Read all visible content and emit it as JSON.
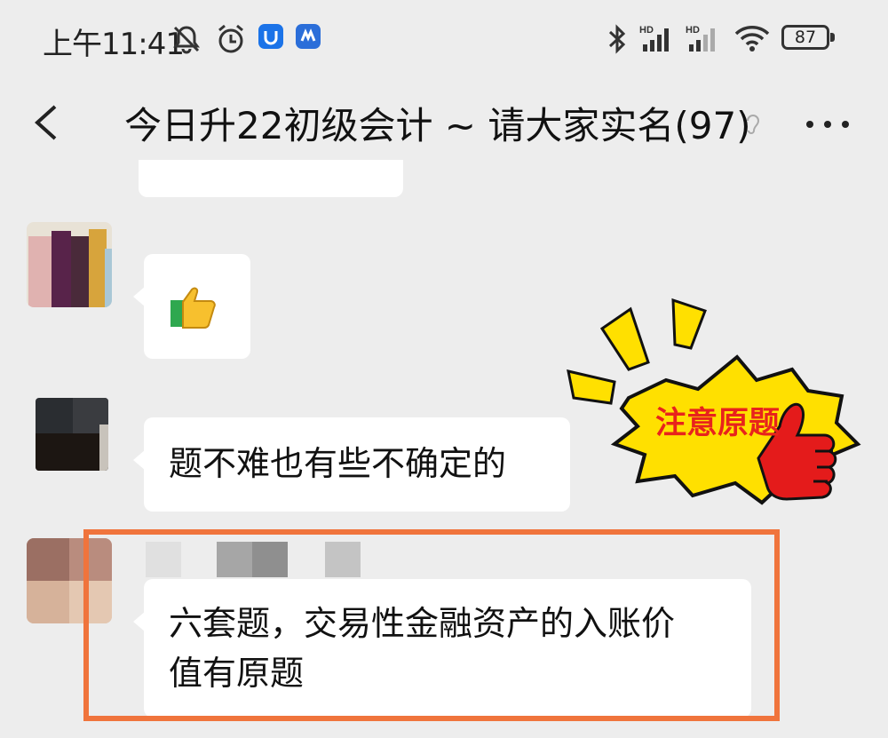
{
  "status_bar": {
    "time": "上午11:41",
    "battery": "87"
  },
  "header": {
    "title": "今日升22初级会计 ~ 请大家实名(97)"
  },
  "messages": [
    {
      "type": "emoji",
      "emoji": "👍"
    },
    {
      "type": "text",
      "text": "题不难也有些不确定的"
    },
    {
      "type": "text",
      "text": "六套题，交易性金融资产的入账价值有原题",
      "lines": [
        "六套题，交易性金融资产的入账价",
        "值有原题"
      ]
    }
  ],
  "annotation": {
    "label": "注意原题",
    "color": "#e8231c",
    "box_color": "#f0743c"
  },
  "colors": {
    "background": "#ededed",
    "bubble": "#ffffff"
  }
}
